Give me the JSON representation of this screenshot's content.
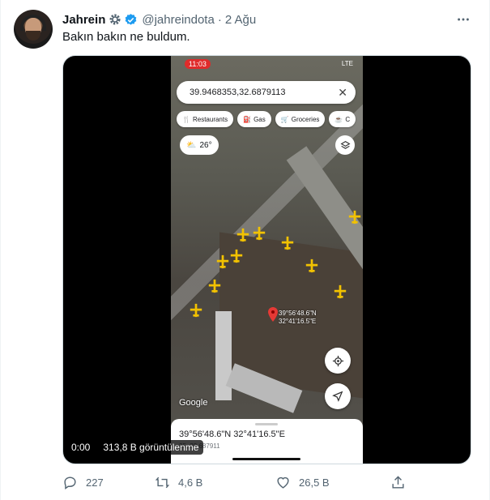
{
  "tweet": {
    "name": "Jahrein",
    "handle": "@jahreindota",
    "separator": "·",
    "time": "2 Ağu",
    "text": "Bakın bakın ne buldum."
  },
  "video": {
    "timestamp": "0:00",
    "views": "313,8 B görüntülenme"
  },
  "maps_app": {
    "clock": "11:03",
    "network": "LTE",
    "search_value": "39.9468353,32.6879113",
    "chips": [
      "Restaurants",
      "Gas",
      "Groceries",
      "C"
    ],
    "weather": "26°",
    "pin_label_line1": "39°56'48.6\"N",
    "pin_label_line2": "32°41'16.5\"E",
    "logo": "Google",
    "sheet_dms": "39°56'48.6\"N 32°41'16.5\"E",
    "sheet_decimal": "35, 32.687911"
  },
  "actions": {
    "reply_count": "227",
    "retweet_count": "4,6 B",
    "like_count": "26,5 B"
  },
  "colors": {
    "verified": "#1d9bf0",
    "secondary_text": "#536471",
    "pin": "#e53935",
    "clock_badge": "#e02b2b"
  },
  "icons": [
    "gear-icon",
    "verified-icon",
    "more-icon",
    "reply-icon",
    "retweet-icon",
    "like-icon",
    "share-icon"
  ]
}
